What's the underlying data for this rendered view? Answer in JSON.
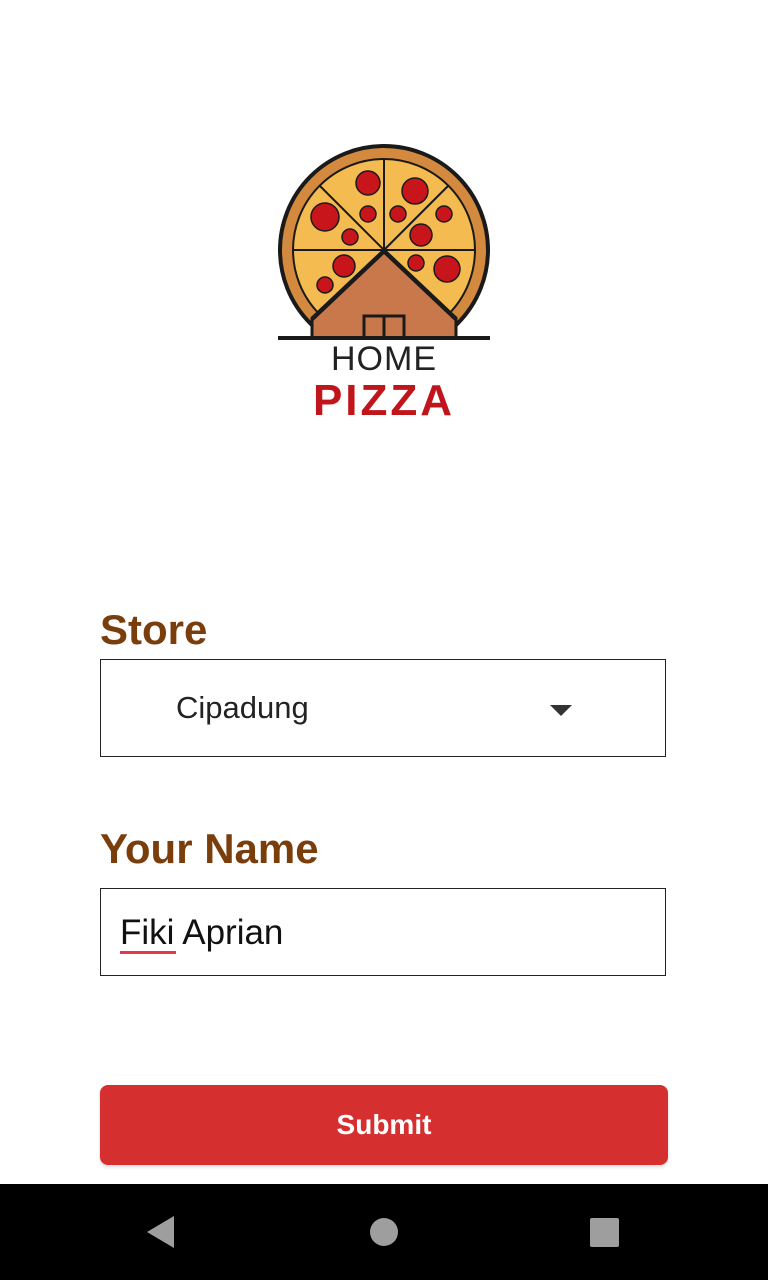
{
  "logo": {
    "line1": "HOME",
    "line2": "PIZZA",
    "colors": {
      "crust": "#d38a3e",
      "cheese": "#f4bb50",
      "pepperoni": "#c8151b",
      "roof": "#c8784a",
      "text_accent": "#c0161b"
    }
  },
  "form": {
    "store": {
      "label": "Store",
      "selected": "Cipadung"
    },
    "name": {
      "label": "Your Name",
      "value": "Fiki Aprian"
    },
    "submit_label": "Submit"
  },
  "navigation": {
    "buttons": [
      "back-icon",
      "home-icon",
      "recents-icon"
    ]
  },
  "colors": {
    "label": "#7a3d0c",
    "button": "#d52f2f",
    "background": "#ffffff",
    "nav_bar": "#000000"
  }
}
